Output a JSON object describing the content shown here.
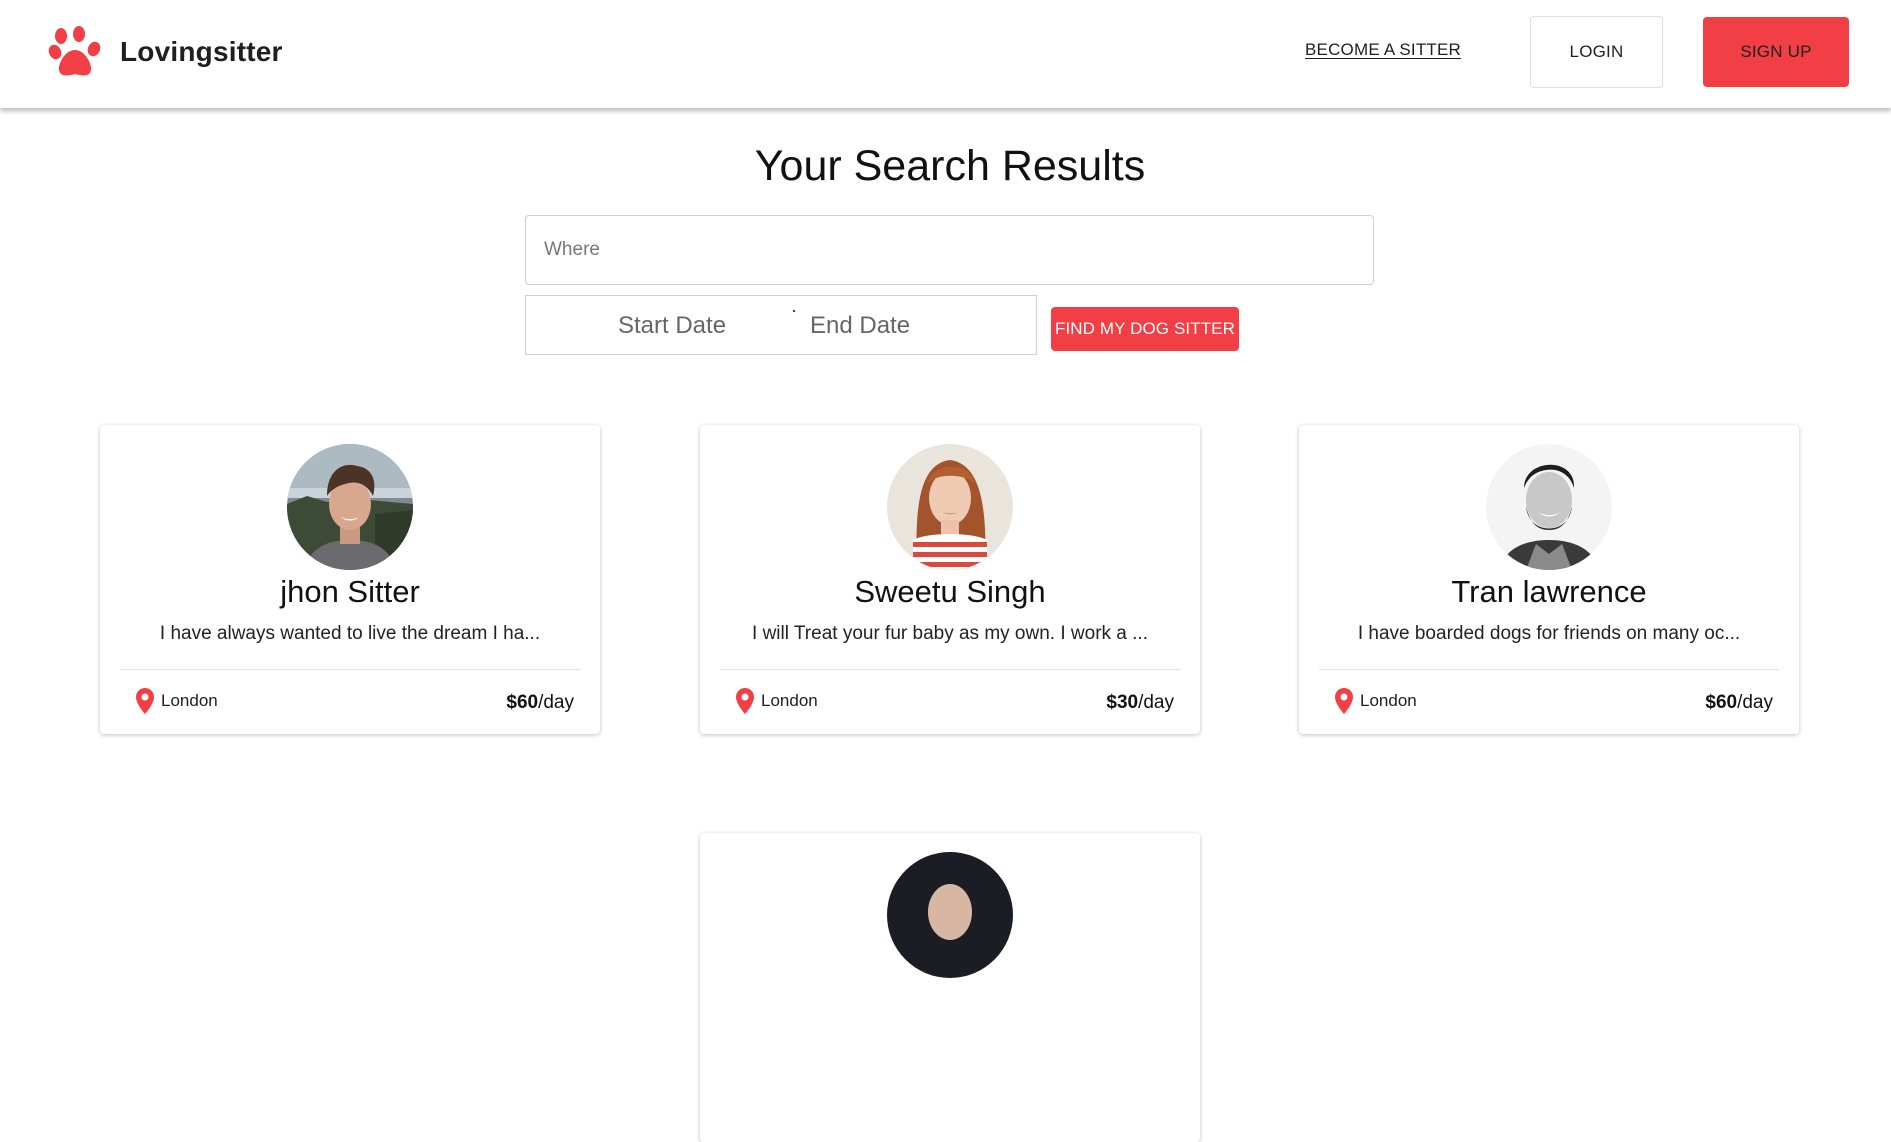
{
  "brand": {
    "name": "Lovingsitter",
    "color": "#f23f45"
  },
  "nav": {
    "become_sitter": "BECOME A SITTER",
    "login": "LOGIN",
    "signup": "SIGN UP"
  },
  "search": {
    "title": "Your Search Results",
    "where_placeholder": "Where",
    "start_date": "Start Date",
    "end_date": "End Date",
    "button": "FIND MY DOG SITTER"
  },
  "sitters": [
    {
      "name": "jhon Sitter",
      "bio": "I have always wanted to live the dream I ha...",
      "location": "London",
      "price": "$60",
      "unit": "/day",
      "avatar": "photo of smiling young man"
    },
    {
      "name": "Sweetu Singh",
      "bio": "I will Treat your fur baby as my own. I work a ...",
      "location": "London",
      "price": "$30",
      "unit": "/day",
      "avatar": "photo of red-haired woman in striped top"
    },
    {
      "name": "Tran lawrence",
      "bio": "I have boarded dogs for friends on many oc...",
      "location": "London",
      "price": "$60",
      "unit": "/day",
      "avatar": "black and white photo of bearded man"
    }
  ]
}
